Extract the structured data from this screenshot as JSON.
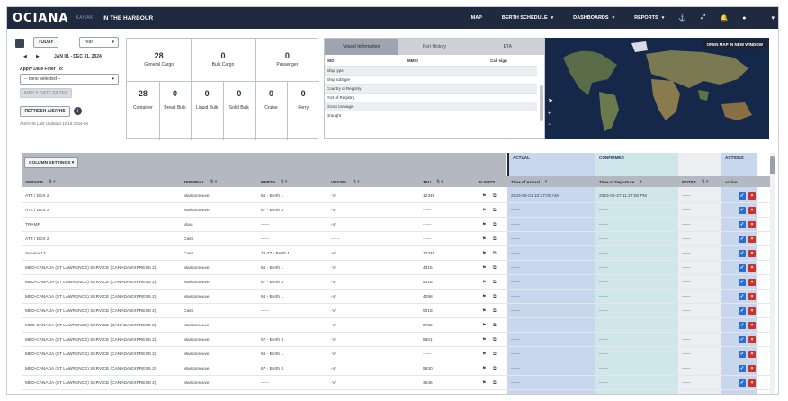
{
  "app": {
    "logo": "OCIANA",
    "brand_sub": "KAHAK",
    "section": "IN THE HARBOUR"
  },
  "nav": {
    "items": [
      {
        "label": "MAP",
        "dropdown": false
      },
      {
        "label": "BERTH SCHEDULE",
        "dropdown": true
      },
      {
        "label": "DASHBOARDS",
        "dropdown": true
      },
      {
        "label": "REPORTS",
        "dropdown": true
      }
    ],
    "icons": [
      "ship-icon",
      "expand-icon",
      "bell-icon",
      "user-icon",
      "chevron-down-icon"
    ]
  },
  "controls": {
    "today_label": "TODAY",
    "range_value": "Year",
    "date_range": "JAN 01 - DEC 31, 2024",
    "date_filter_label": "Apply Date Filter To:",
    "date_filter_value": "-- none selected --",
    "apply_filter_label": "APPLY DATE FILTER",
    "refresh_label": "REFRESH AIS/VHS",
    "last_updated": "AIS/VHS Last Updated 12:15 2024-04"
  },
  "counts": {
    "top": [
      {
        "value": "28",
        "label": "General Cargo"
      },
      {
        "value": "0",
        "label": "Bulk Cargo"
      },
      {
        "value": "0",
        "label": "Passenger"
      }
    ],
    "bottom": [
      {
        "value": "28",
        "label": "Container"
      },
      {
        "value": "0",
        "label": "Break Bulk"
      },
      {
        "value": "0",
        "label": "Liquid Bulk"
      },
      {
        "value": "0",
        "label": "Solid Bulk"
      },
      {
        "value": "0",
        "label": "Cruise"
      },
      {
        "value": "0",
        "label": "Ferry"
      }
    ]
  },
  "vessel_panel": {
    "tabs": [
      "Vessel Information",
      "Port History",
      "ETA"
    ],
    "columns": [
      "IMO",
      "MMSI",
      "Call sign"
    ],
    "rows": [
      "Ship type",
      "Ship subtype",
      "Country of Registry",
      "Port of Registry",
      "Gross tonnage",
      "Draught"
    ]
  },
  "map": {
    "open_label": "OPEN MAP IN NEW WINDOW"
  },
  "table": {
    "column_settings": "COLUMN SETTINGS",
    "group_actual": "ACTUAL",
    "group_confirmed": "CONFIRMED",
    "group_actions": "ACTIONS",
    "headers": {
      "service": "SERVICE",
      "terminal": "TERMINAL",
      "berth": "BERTH",
      "vessel": "VESSEL",
      "teu": "TEU",
      "alerts": "ALERTS",
      "actual": "Time of Arrival",
      "confirmed": "Time of Departure",
      "notes": "NOTES",
      "actions": "action"
    },
    "rows": [
      {
        "service": "ATZ / DEX 2",
        "terminal": "Maisonneuve",
        "berth": "66 - Berth 1",
        "vessel": "-V",
        "teu": "12345",
        "actual": "2023-08-01 10:27:00 AM",
        "confirmed": "2023-08-27 11:27:00 PM",
        "notes": "------"
      },
      {
        "service": "ATZ / DEX 2",
        "terminal": "Maisonneuve",
        "berth": "67 - Berth 3",
        "vessel": "-V",
        "teu": "------",
        "actual": "------",
        "confirmed": "------",
        "notes": "------"
      },
      {
        "service": "TRAMP",
        "terminal": "Viau",
        "berth": "------",
        "vessel": "-V",
        "teu": "------",
        "actual": "------",
        "confirmed": "------",
        "notes": "------"
      },
      {
        "service": "ATZ / DEX 2",
        "terminal": "Cast",
        "berth": "------",
        "vessel": "------",
        "teu": "------",
        "actual": "------",
        "confirmed": "------",
        "notes": "------"
      },
      {
        "service": "Service 12",
        "terminal": "Cast",
        "berth": "76-77 - Berth 1",
        "vessel": "-V",
        "teu": "12345",
        "actual": "------",
        "confirmed": "------",
        "notes": "------"
      },
      {
        "service": "MED-CANADA (ST LAWRENCE) SERVICE (CANADA EXPRESS 2)",
        "terminal": "Maisonneuve",
        "berth": "66 - Berth 1",
        "vessel": "-V",
        "teu": "4315",
        "actual": "------",
        "confirmed": "------",
        "notes": "------"
      },
      {
        "service": "MED-CANADA (ST LAWRENCE) SERVICE (CANADA EXPRESS 2)",
        "terminal": "Maisonneuve",
        "berth": "67 - Berth 3",
        "vessel": "-V",
        "teu": "5018",
        "actual": "------",
        "confirmed": "------",
        "notes": "------"
      },
      {
        "service": "MED-CANADA (ST LAWRENCE) SERVICE (CANADA EXPRESS 2)",
        "terminal": "Maisonneuve",
        "berth": "66 - Berth 1",
        "vessel": "-V",
        "teu": "4298",
        "actual": "------",
        "confirmed": "------",
        "notes": "------"
      },
      {
        "service": "MED-CANADA (ST LAWRENCE) SERVICE (CANADA EXPRESS 2)",
        "terminal": "Cast",
        "berth": "------",
        "vessel": "-V",
        "teu": "5018",
        "actual": "------",
        "confirmed": "------",
        "notes": "------"
      },
      {
        "service": "MED-CANADA (ST LAWRENCE) SERVICE (CANADA EXPRESS 2)",
        "terminal": "Maisonneuve",
        "berth": "------",
        "vessel": "-V",
        "teu": "2722",
        "actual": "------",
        "confirmed": "------",
        "notes": "------"
      },
      {
        "service": "MED-CANADA (ST LAWRENCE) SERVICE (CANADA EXPRESS 2)",
        "terminal": "Maisonneuve",
        "berth": "67 - Berth 3",
        "vessel": "-V",
        "teu": "5601",
        "actual": "------",
        "confirmed": "------",
        "notes": "------"
      },
      {
        "service": "MED-CANADA (ST LAWRENCE) SERVICE (CANADA EXPRESS 2)",
        "terminal": "Maisonneuve",
        "berth": "66 - Berth 1",
        "vessel": "-V",
        "teu": "------",
        "actual": "------",
        "confirmed": "------",
        "notes": "------"
      },
      {
        "service": "MED-CANADA (ST LAWRENCE) SERVICE (CANADA EXPRESS 2)",
        "terminal": "Maisonneuve",
        "berth": "67 - Berth 3",
        "vessel": "-V",
        "teu": "5930",
        "actual": "------",
        "confirmed": "------",
        "notes": "------"
      },
      {
        "service": "MED-CANADA (ST LAWRENCE) SERVICE (CANADA EXPRESS 2)",
        "terminal": "Maisonneuve",
        "berth": "------",
        "vessel": "-V",
        "teu": "3645",
        "actual": "------",
        "confirmed": "------",
        "notes": "------"
      },
      {
        "service": "MED-CANADA (ST LAWRENCE) SERVICE (CANADA EXPRESS 2)",
        "terminal": "Maisonneuve",
        "berth": "66 - Berth 1",
        "vessel": "-V",
        "teu": "------",
        "actual": "------",
        "confirmed": "------",
        "notes": "------"
      }
    ]
  },
  "colors": {
    "nav_bg": "#1f2a3f",
    "actual_col": "#c9d7ee",
    "confirmed_col": "#cfe6ea",
    "edit_btn": "#2b6ed3",
    "delete_btn": "#c9322d"
  }
}
